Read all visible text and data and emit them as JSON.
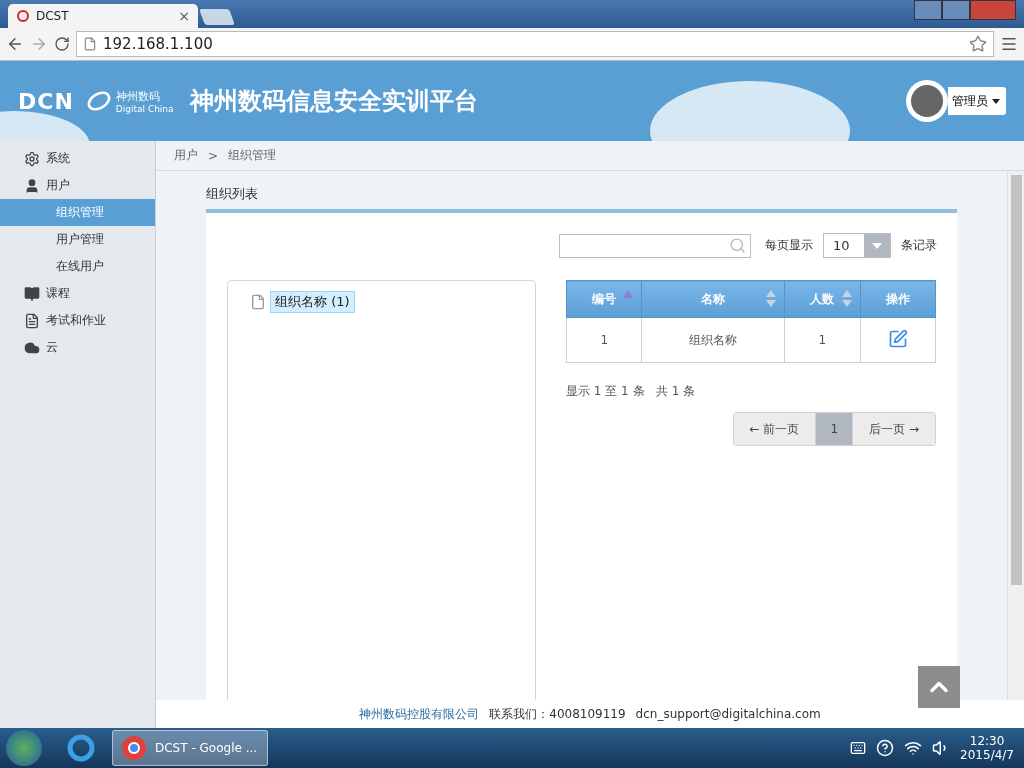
{
  "browser": {
    "tabs": [
      {
        "title": "DCST",
        "selected": true,
        "close": "×"
      }
    ],
    "url": "192.168.1.100"
  },
  "header": {
    "logo": "DCN",
    "brand_cn": "神州数码",
    "brand_en": "Digital China",
    "title": "神州数码信息安全实训平台",
    "user": "管理员"
  },
  "sidebar": {
    "items": [
      {
        "label": "系统",
        "selected": false
      },
      {
        "label": "用户",
        "selected": false,
        "expanded": true,
        "children": [
          {
            "label": "组织管理",
            "selected": true
          },
          {
            "label": "用户管理",
            "selected": false
          },
          {
            "label": "在线用户",
            "selected": false
          }
        ]
      },
      {
        "label": "课程",
        "selected": false
      },
      {
        "label": "考试和作业",
        "selected": false
      },
      {
        "label": "云",
        "selected": false
      }
    ]
  },
  "breadcrumb": [
    "用户",
    "组织管理"
  ],
  "breadcrumb_separator": ">",
  "section_title": "组织列表",
  "tree": {
    "items": [
      {
        "label": "组织名称 (1)",
        "selected": true
      }
    ]
  },
  "controls": {
    "per_page_label": "每页显示",
    "per_page_value": "10",
    "per_page_suffix": "条记录"
  },
  "table": {
    "columns": [
      {
        "label": "编号",
        "sortable": true,
        "sorted": true
      },
      {
        "label": "名称",
        "sortable": true,
        "sorted": false
      },
      {
        "label": "人数",
        "sortable": true,
        "sorted": false
      },
      {
        "label": "操作",
        "sortable": false
      }
    ],
    "rows": [
      {
        "cells": [
          "1",
          "组织名称",
          "1"
        ],
        "editable": true
      }
    ]
  },
  "summary": "显示 1 至 1 条   共 1 条",
  "pagination": {
    "prev": "← 前一页",
    "pages": [
      {
        "label": "1",
        "selected": true
      }
    ],
    "next": "后一页 →"
  },
  "footer": {
    "company": "神州数码控股有限公司",
    "contact": "联系我们：4008109119",
    "email": "dcn_support@digitalchina.com"
  },
  "taskbar": {
    "tasks": [
      {
        "label": "DCST - Google ...",
        "selected": true
      }
    ],
    "time": "12:30",
    "date": "2015/4/7"
  }
}
